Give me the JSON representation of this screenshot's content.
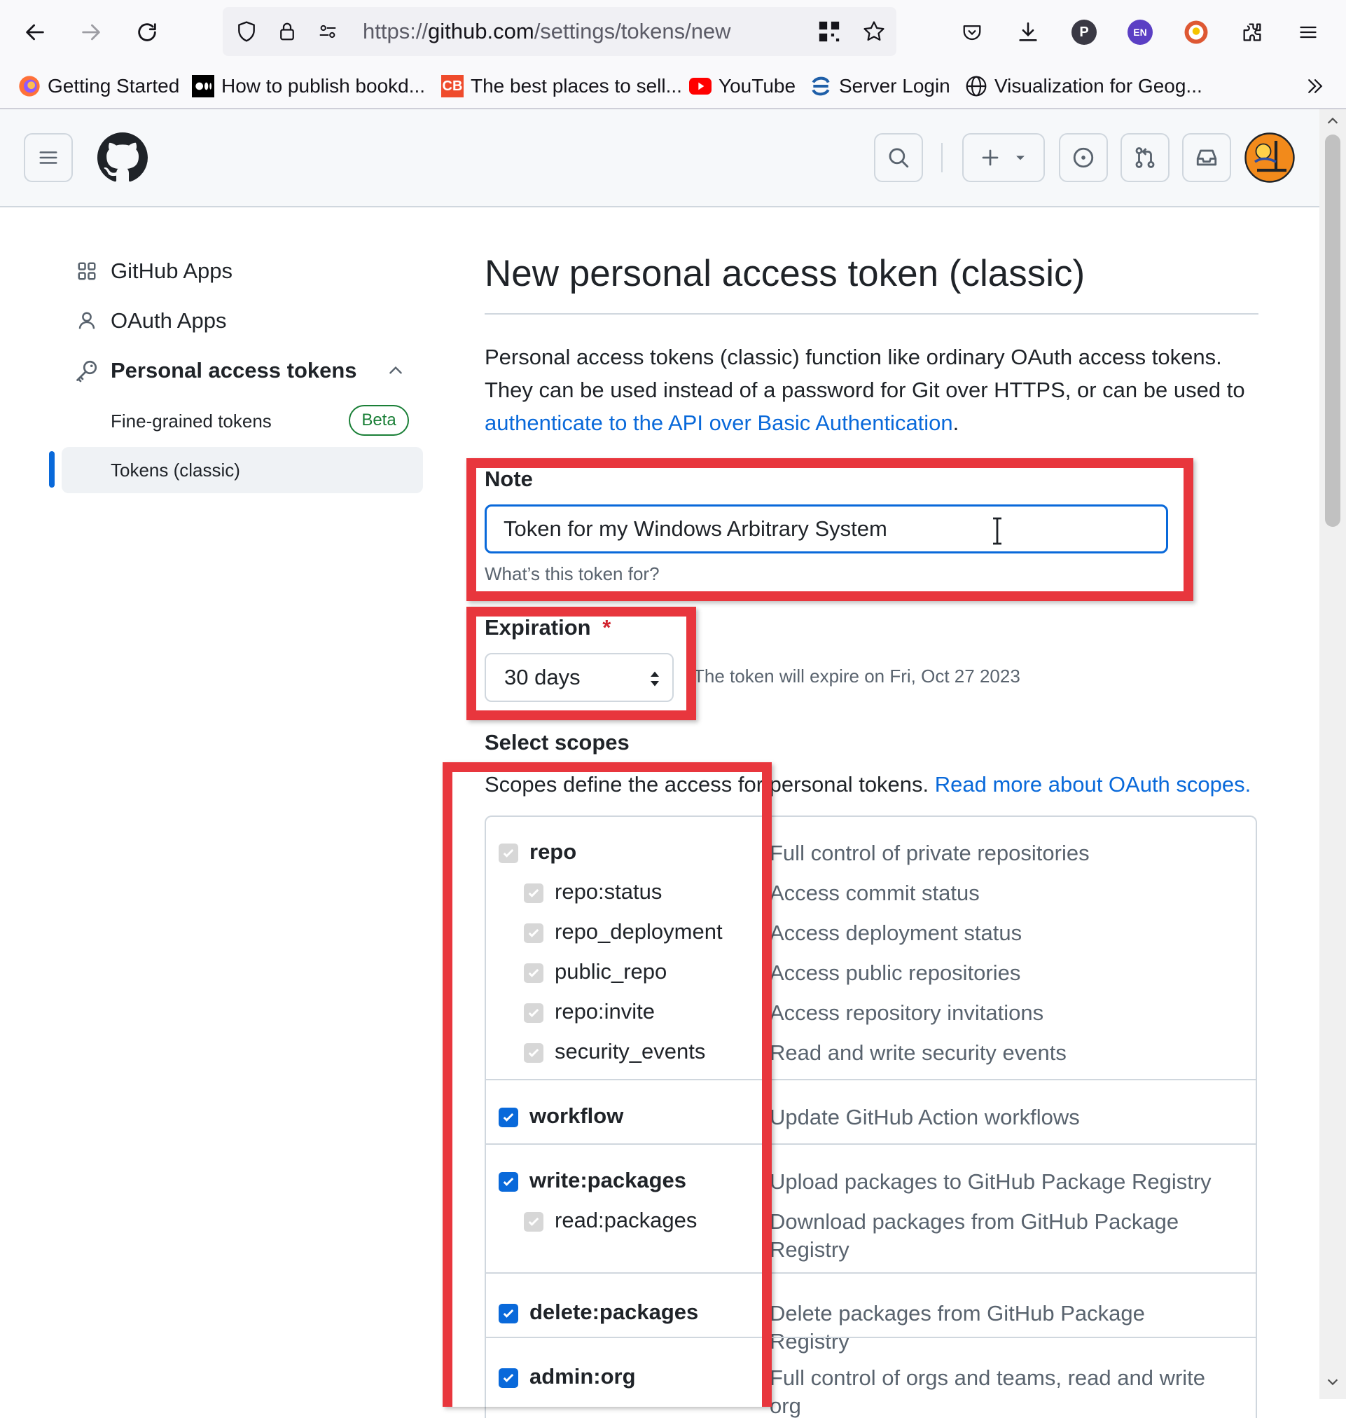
{
  "browser": {
    "url_prefix": "https://",
    "url_host": "github.com",
    "url_path": "/settings/tokens/new",
    "profile_initial": "P",
    "lang_badge": "EN",
    "bookmarks": [
      {
        "label": "Getting Started",
        "icon": "firefox-icon"
      },
      {
        "label": "How to publish bookd...",
        "icon": "medium-icon"
      },
      {
        "label": "The best places to sell...",
        "icon": "cb-icon"
      },
      {
        "label": "YouTube",
        "icon": "youtube-icon"
      },
      {
        "label": "Server Login",
        "icon": "server-icon"
      },
      {
        "label": "Visualization for Geog...",
        "icon": "globe-icon"
      }
    ],
    "cb_text": "CB"
  },
  "sidebar": {
    "items": [
      {
        "label": "GitHub Apps",
        "icon": "apps-icon"
      },
      {
        "label": "OAuth Apps",
        "icon": "person-icon"
      },
      {
        "label": "Personal access tokens",
        "icon": "key-icon"
      }
    ],
    "sub_items": [
      {
        "label": "Fine-grained tokens",
        "badge": "Beta"
      },
      {
        "label": "Tokens (classic)",
        "selected": true
      }
    ]
  },
  "main": {
    "title": "New personal access token (classic)",
    "intro_text": "Personal access tokens (classic) function like ordinary OAuth access tokens. They can be used instead of a password for Git over HTTPS, or can be used to ",
    "intro_link": "authenticate to the API over Basic Authentication",
    "intro_end": ".",
    "note_label": "Note",
    "note_value": "Token for my Windows Arbitrary System",
    "note_hint": "What’s this token for?",
    "expiration_label": "Expiration",
    "required_mark": "*",
    "expiration_value": "30 days",
    "expiration_note": "The token will expire on Fri, Oct 27 2023",
    "scopes_heading": "Select scopes",
    "scopes_desc": "Scopes define the access for personal tokens. ",
    "scopes_link": "Read more about OAuth scopes.",
    "scopes": [
      {
        "name": "repo",
        "desc": "Full control of private repositories",
        "checked": true,
        "level": 0,
        "state": "disabled"
      },
      {
        "name": "repo:status",
        "desc": "Access commit status",
        "checked": true,
        "level": 1,
        "state": "disabled"
      },
      {
        "name": "repo_deployment",
        "desc": "Access deployment status",
        "checked": true,
        "level": 1,
        "state": "disabled"
      },
      {
        "name": "public_repo",
        "desc": "Access public repositories",
        "checked": true,
        "level": 1,
        "state": "disabled"
      },
      {
        "name": "repo:invite",
        "desc": "Access repository invitations",
        "checked": true,
        "level": 1,
        "state": "disabled"
      },
      {
        "name": "security_events",
        "desc": "Read and write security events",
        "checked": true,
        "level": 1,
        "state": "disabled"
      },
      {
        "name": "workflow",
        "desc": "Update GitHub Action workflows",
        "checked": true,
        "level": 0,
        "state": "enabled"
      },
      {
        "name": "write:packages",
        "desc": "Upload packages to GitHub Package Registry",
        "checked": true,
        "level": 0,
        "state": "enabled"
      },
      {
        "name": "read:packages",
        "desc": "Download packages from GitHub Package Registry",
        "checked": true,
        "level": 1,
        "state": "disabled"
      },
      {
        "name": "delete:packages",
        "desc": "Delete packages from GitHub Package Registry",
        "checked": true,
        "level": 0,
        "state": "enabled"
      },
      {
        "name": "admin:org",
        "desc": "Full control of orgs and teams, read and write org",
        "checked": true,
        "level": 0,
        "state": "enabled"
      }
    ]
  },
  "colors": {
    "accent": "#0969da",
    "annotation": "#e8363d",
    "badge_green": "#1a7f37"
  }
}
